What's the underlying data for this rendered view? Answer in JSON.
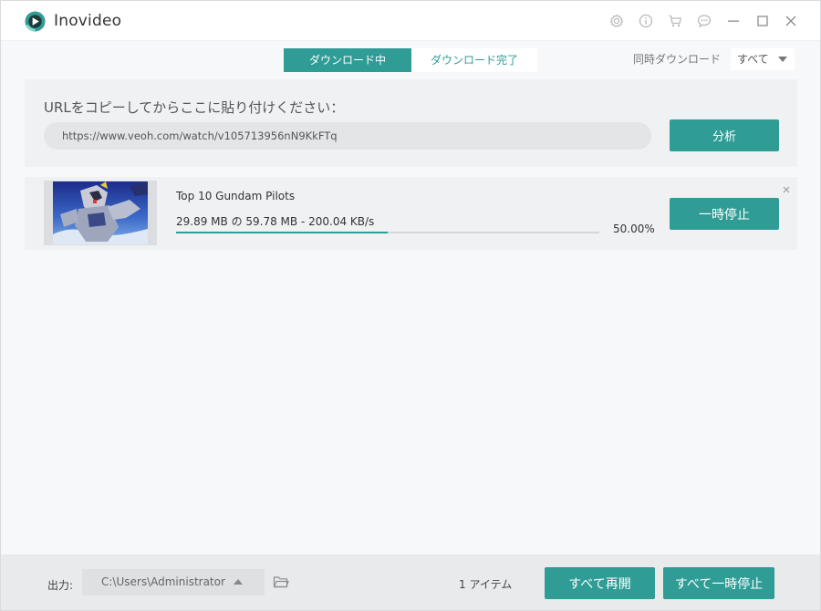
{
  "app": {
    "title": "Inovideo",
    "accent_color": "#2f9c95",
    "title_icons": [
      "settings-icon",
      "info-icon",
      "cart-icon",
      "feedback-icon",
      "minimize-icon",
      "maximize-icon",
      "close-icon"
    ]
  },
  "tabs": {
    "downloading": "ダウンロード中",
    "completed": "ダウンロード完了"
  },
  "concurrent": {
    "label": "同時ダウンロード",
    "selected": "すべて"
  },
  "url_panel": {
    "heading": "URLをコピーしてからここに貼り付けください：",
    "url_value": "https://www.veoh.com/watch/v105713956nN9KkFTq",
    "analyze_label": "分析"
  },
  "downloads": [
    {
      "title": "Top 10 Gundam Pilots",
      "progress_text": "29.89 MB の 59.78 MB - 200.04 KB/s",
      "percent_label": "50.00%",
      "progress_fraction": 0.5,
      "pause_label": "一時停止"
    }
  ],
  "footer": {
    "output_label": "出力:",
    "output_path": "C:\\Users\\Administrator\\",
    "item_count": "1 アイテム",
    "resume_all_label": "すべて再開",
    "pause_all_label": "すべて一時停止"
  }
}
